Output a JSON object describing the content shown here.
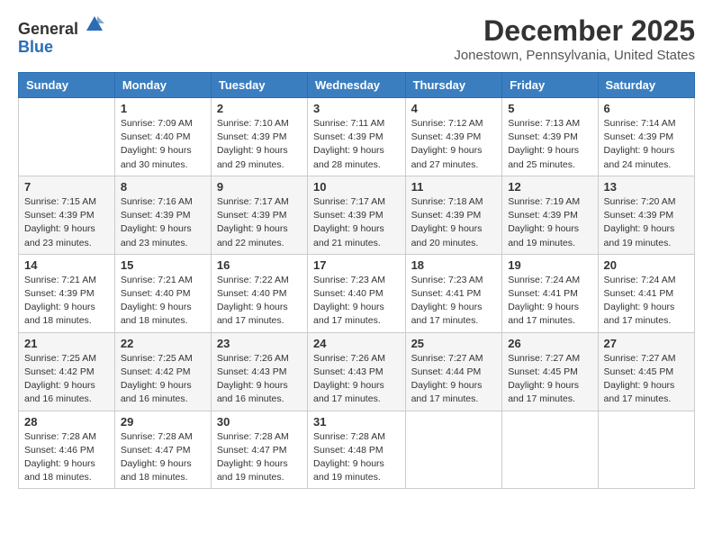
{
  "header": {
    "logo_general": "General",
    "logo_blue": "Blue",
    "month": "December 2025",
    "location": "Jonestown, Pennsylvania, United States"
  },
  "days_of_week": [
    "Sunday",
    "Monday",
    "Tuesday",
    "Wednesday",
    "Thursday",
    "Friday",
    "Saturday"
  ],
  "weeks": [
    [
      {
        "day": "",
        "info": ""
      },
      {
        "day": "1",
        "info": "Sunrise: 7:09 AM\nSunset: 4:40 PM\nDaylight: 9 hours\nand 30 minutes."
      },
      {
        "day": "2",
        "info": "Sunrise: 7:10 AM\nSunset: 4:39 PM\nDaylight: 9 hours\nand 29 minutes."
      },
      {
        "day": "3",
        "info": "Sunrise: 7:11 AM\nSunset: 4:39 PM\nDaylight: 9 hours\nand 28 minutes."
      },
      {
        "day": "4",
        "info": "Sunrise: 7:12 AM\nSunset: 4:39 PM\nDaylight: 9 hours\nand 27 minutes."
      },
      {
        "day": "5",
        "info": "Sunrise: 7:13 AM\nSunset: 4:39 PM\nDaylight: 9 hours\nand 25 minutes."
      },
      {
        "day": "6",
        "info": "Sunrise: 7:14 AM\nSunset: 4:39 PM\nDaylight: 9 hours\nand 24 minutes."
      }
    ],
    [
      {
        "day": "7",
        "info": "Sunrise: 7:15 AM\nSunset: 4:39 PM\nDaylight: 9 hours\nand 23 minutes."
      },
      {
        "day": "8",
        "info": "Sunrise: 7:16 AM\nSunset: 4:39 PM\nDaylight: 9 hours\nand 23 minutes."
      },
      {
        "day": "9",
        "info": "Sunrise: 7:17 AM\nSunset: 4:39 PM\nDaylight: 9 hours\nand 22 minutes."
      },
      {
        "day": "10",
        "info": "Sunrise: 7:17 AM\nSunset: 4:39 PM\nDaylight: 9 hours\nand 21 minutes."
      },
      {
        "day": "11",
        "info": "Sunrise: 7:18 AM\nSunset: 4:39 PM\nDaylight: 9 hours\nand 20 minutes."
      },
      {
        "day": "12",
        "info": "Sunrise: 7:19 AM\nSunset: 4:39 PM\nDaylight: 9 hours\nand 19 minutes."
      },
      {
        "day": "13",
        "info": "Sunrise: 7:20 AM\nSunset: 4:39 PM\nDaylight: 9 hours\nand 19 minutes."
      }
    ],
    [
      {
        "day": "14",
        "info": "Sunrise: 7:21 AM\nSunset: 4:39 PM\nDaylight: 9 hours\nand 18 minutes."
      },
      {
        "day": "15",
        "info": "Sunrise: 7:21 AM\nSunset: 4:40 PM\nDaylight: 9 hours\nand 18 minutes."
      },
      {
        "day": "16",
        "info": "Sunrise: 7:22 AM\nSunset: 4:40 PM\nDaylight: 9 hours\nand 17 minutes."
      },
      {
        "day": "17",
        "info": "Sunrise: 7:23 AM\nSunset: 4:40 PM\nDaylight: 9 hours\nand 17 minutes."
      },
      {
        "day": "18",
        "info": "Sunrise: 7:23 AM\nSunset: 4:41 PM\nDaylight: 9 hours\nand 17 minutes."
      },
      {
        "day": "19",
        "info": "Sunrise: 7:24 AM\nSunset: 4:41 PM\nDaylight: 9 hours\nand 17 minutes."
      },
      {
        "day": "20",
        "info": "Sunrise: 7:24 AM\nSunset: 4:41 PM\nDaylight: 9 hours\nand 17 minutes."
      }
    ],
    [
      {
        "day": "21",
        "info": "Sunrise: 7:25 AM\nSunset: 4:42 PM\nDaylight: 9 hours\nand 16 minutes."
      },
      {
        "day": "22",
        "info": "Sunrise: 7:25 AM\nSunset: 4:42 PM\nDaylight: 9 hours\nand 16 minutes."
      },
      {
        "day": "23",
        "info": "Sunrise: 7:26 AM\nSunset: 4:43 PM\nDaylight: 9 hours\nand 16 minutes."
      },
      {
        "day": "24",
        "info": "Sunrise: 7:26 AM\nSunset: 4:43 PM\nDaylight: 9 hours\nand 17 minutes."
      },
      {
        "day": "25",
        "info": "Sunrise: 7:27 AM\nSunset: 4:44 PM\nDaylight: 9 hours\nand 17 minutes."
      },
      {
        "day": "26",
        "info": "Sunrise: 7:27 AM\nSunset: 4:45 PM\nDaylight: 9 hours\nand 17 minutes."
      },
      {
        "day": "27",
        "info": "Sunrise: 7:27 AM\nSunset: 4:45 PM\nDaylight: 9 hours\nand 17 minutes."
      }
    ],
    [
      {
        "day": "28",
        "info": "Sunrise: 7:28 AM\nSunset: 4:46 PM\nDaylight: 9 hours\nand 18 minutes."
      },
      {
        "day": "29",
        "info": "Sunrise: 7:28 AM\nSunset: 4:47 PM\nDaylight: 9 hours\nand 18 minutes."
      },
      {
        "day": "30",
        "info": "Sunrise: 7:28 AM\nSunset: 4:47 PM\nDaylight: 9 hours\nand 19 minutes."
      },
      {
        "day": "31",
        "info": "Sunrise: 7:28 AM\nSunset: 4:48 PM\nDaylight: 9 hours\nand 19 minutes."
      },
      {
        "day": "",
        "info": ""
      },
      {
        "day": "",
        "info": ""
      },
      {
        "day": "",
        "info": ""
      }
    ]
  ]
}
